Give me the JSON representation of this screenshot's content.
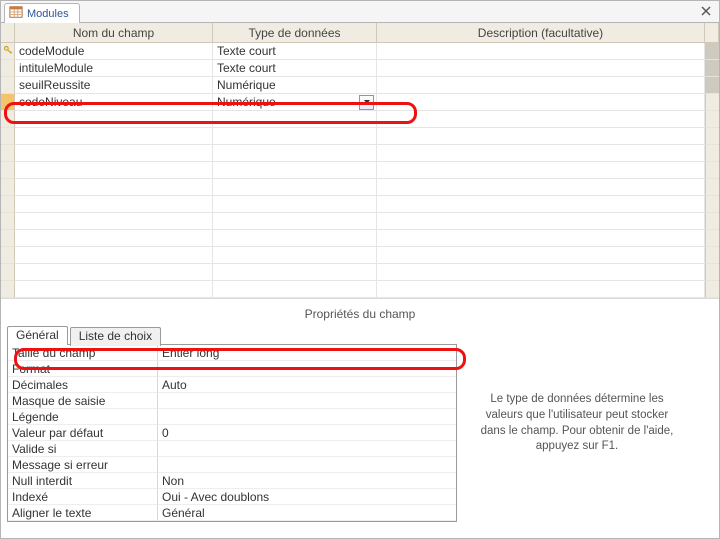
{
  "tab": {
    "title": "Modules"
  },
  "grid": {
    "headers": {
      "name": "Nom du champ",
      "type": "Type de données",
      "desc": "Description (facultative)"
    },
    "rows": [
      {
        "pk": true,
        "name": "codeModule",
        "type": "Texte court",
        "desc": ""
      },
      {
        "pk": false,
        "name": "intituleModule",
        "type": "Texte court",
        "desc": ""
      },
      {
        "pk": false,
        "name": "seuilReussite",
        "type": "Numérique",
        "desc": ""
      },
      {
        "pk": false,
        "name": "codeNiveau",
        "type": "Numérique",
        "desc": "",
        "selected": true,
        "dropdown": true
      }
    ]
  },
  "props_title": "Propriétés du champ",
  "props_tabs": {
    "general": "Général",
    "lookup": "Liste de choix"
  },
  "props": [
    {
      "label": "Taille du champ",
      "value": "Entier long"
    },
    {
      "label": "Format",
      "value": ""
    },
    {
      "label": "Décimales",
      "value": "Auto"
    },
    {
      "label": "Masque de saisie",
      "value": ""
    },
    {
      "label": "Légende",
      "value": ""
    },
    {
      "label": "Valeur par défaut",
      "value": "0"
    },
    {
      "label": "Valide si",
      "value": ""
    },
    {
      "label": "Message si erreur",
      "value": ""
    },
    {
      "label": "Null interdit",
      "value": "Non"
    },
    {
      "label": "Indexé",
      "value": "Oui - Avec doublons"
    },
    {
      "label": "Aligner le texte",
      "value": "Général"
    }
  ],
  "help": "Le type de données détermine les valeurs que l'utilisateur peut stocker dans le champ. Pour obtenir de l'aide, appuyez sur F1.",
  "empty_rows": 11
}
